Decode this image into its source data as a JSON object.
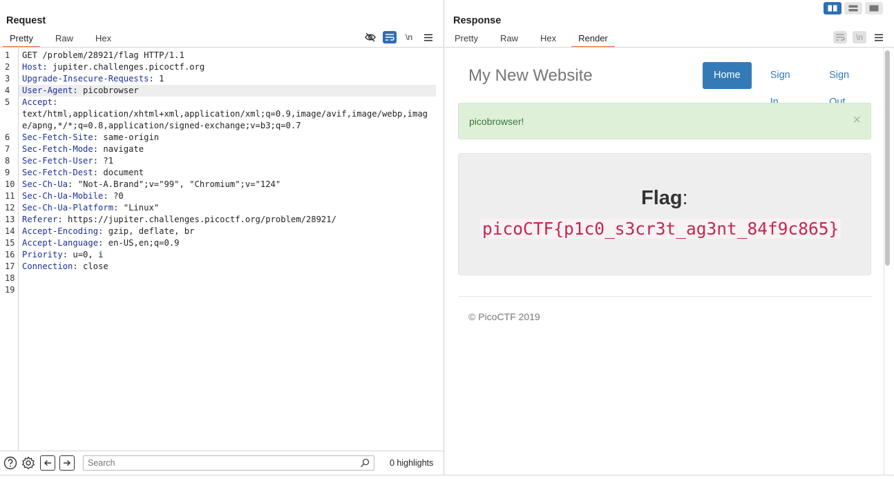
{
  "request": {
    "title": "Request",
    "tabs": [
      "Pretty",
      "Raw",
      "Hex"
    ],
    "active_tab": 0,
    "toolbar": {
      "newline_label": "\\n"
    },
    "lines": [
      {
        "n": "1",
        "key": "",
        "val": "GET /problem/28921/flag HTTP/1.1"
      },
      {
        "n": "2",
        "key": "Host",
        "val": " jupiter.challenges.picoctf.org"
      },
      {
        "n": "3",
        "key": "Upgrade-Insecure-Requests",
        "val": " 1"
      },
      {
        "n": "4",
        "key": "User-Agent",
        "val": " picobrowser"
      },
      {
        "n": "5",
        "key": "Accept",
        "val": "",
        "cont": "text/html,application/xhtml+xml,application/xml;q=0.9,image/avif,image/webp,image/apng,*/*;q=0.8,application/signed-exchange;v=b3;q=0.7"
      },
      {
        "n": "6",
        "key": "Sec-Fetch-Site",
        "val": " same-origin"
      },
      {
        "n": "7",
        "key": "Sec-Fetch-Mode",
        "val": " navigate"
      },
      {
        "n": "8",
        "key": "Sec-Fetch-User",
        "val": " ?1"
      },
      {
        "n": "9",
        "key": "Sec-Fetch-Dest",
        "val": " document"
      },
      {
        "n": "10",
        "key": "Sec-Ch-Ua",
        "val": " \"Not-A.Brand\";v=\"99\", \"Chromium\";v=\"124\""
      },
      {
        "n": "11",
        "key": "Sec-Ch-Ua-Mobile",
        "val": " ?0"
      },
      {
        "n": "12",
        "key": "Sec-Ch-Ua-Platform",
        "val": " \"Linux\""
      },
      {
        "n": "13",
        "key": "Referer",
        "val": " https://jupiter.challenges.picoctf.org/problem/28921/"
      },
      {
        "n": "14",
        "key": "Accept-Encoding",
        "val": " gzip, deflate, br"
      },
      {
        "n": "15",
        "key": "Accept-Language",
        "val": " en-US,en;q=0.9"
      },
      {
        "n": "16",
        "key": "Priority",
        "val": " u=0, i"
      },
      {
        "n": "17",
        "key": "Connection",
        "val": " close"
      },
      {
        "n": "18",
        "key": "",
        "val": ""
      },
      {
        "n": "19",
        "key": "",
        "val": ""
      }
    ],
    "highlighted_line": 3,
    "search": {
      "placeholder": "Search",
      "value": ""
    },
    "highlights": "0 highlights"
  },
  "response": {
    "title": "Response",
    "tabs": [
      "Pretty",
      "Raw",
      "Hex",
      "Render"
    ],
    "active_tab": 3,
    "toolbar": {
      "newline_label": "\\n"
    },
    "site": {
      "title": "My New Website",
      "nav": [
        "Home",
        "Sign In",
        "Sign Out"
      ],
      "nav_active": 0,
      "alert": "picobrowser!",
      "alert_close": "×",
      "flag_label": "Flag",
      "flag_colon": ":",
      "flag_value": "picoCTF{p1c0_s3cr3t_ag3nt_84f9c865}",
      "footer": "© PicoCTF 2019"
    }
  },
  "colors": {
    "accent_tab": "#e8642c",
    "toggle_active": "#2f6db5",
    "link": "#337ab7",
    "flag": "#c7254e"
  }
}
